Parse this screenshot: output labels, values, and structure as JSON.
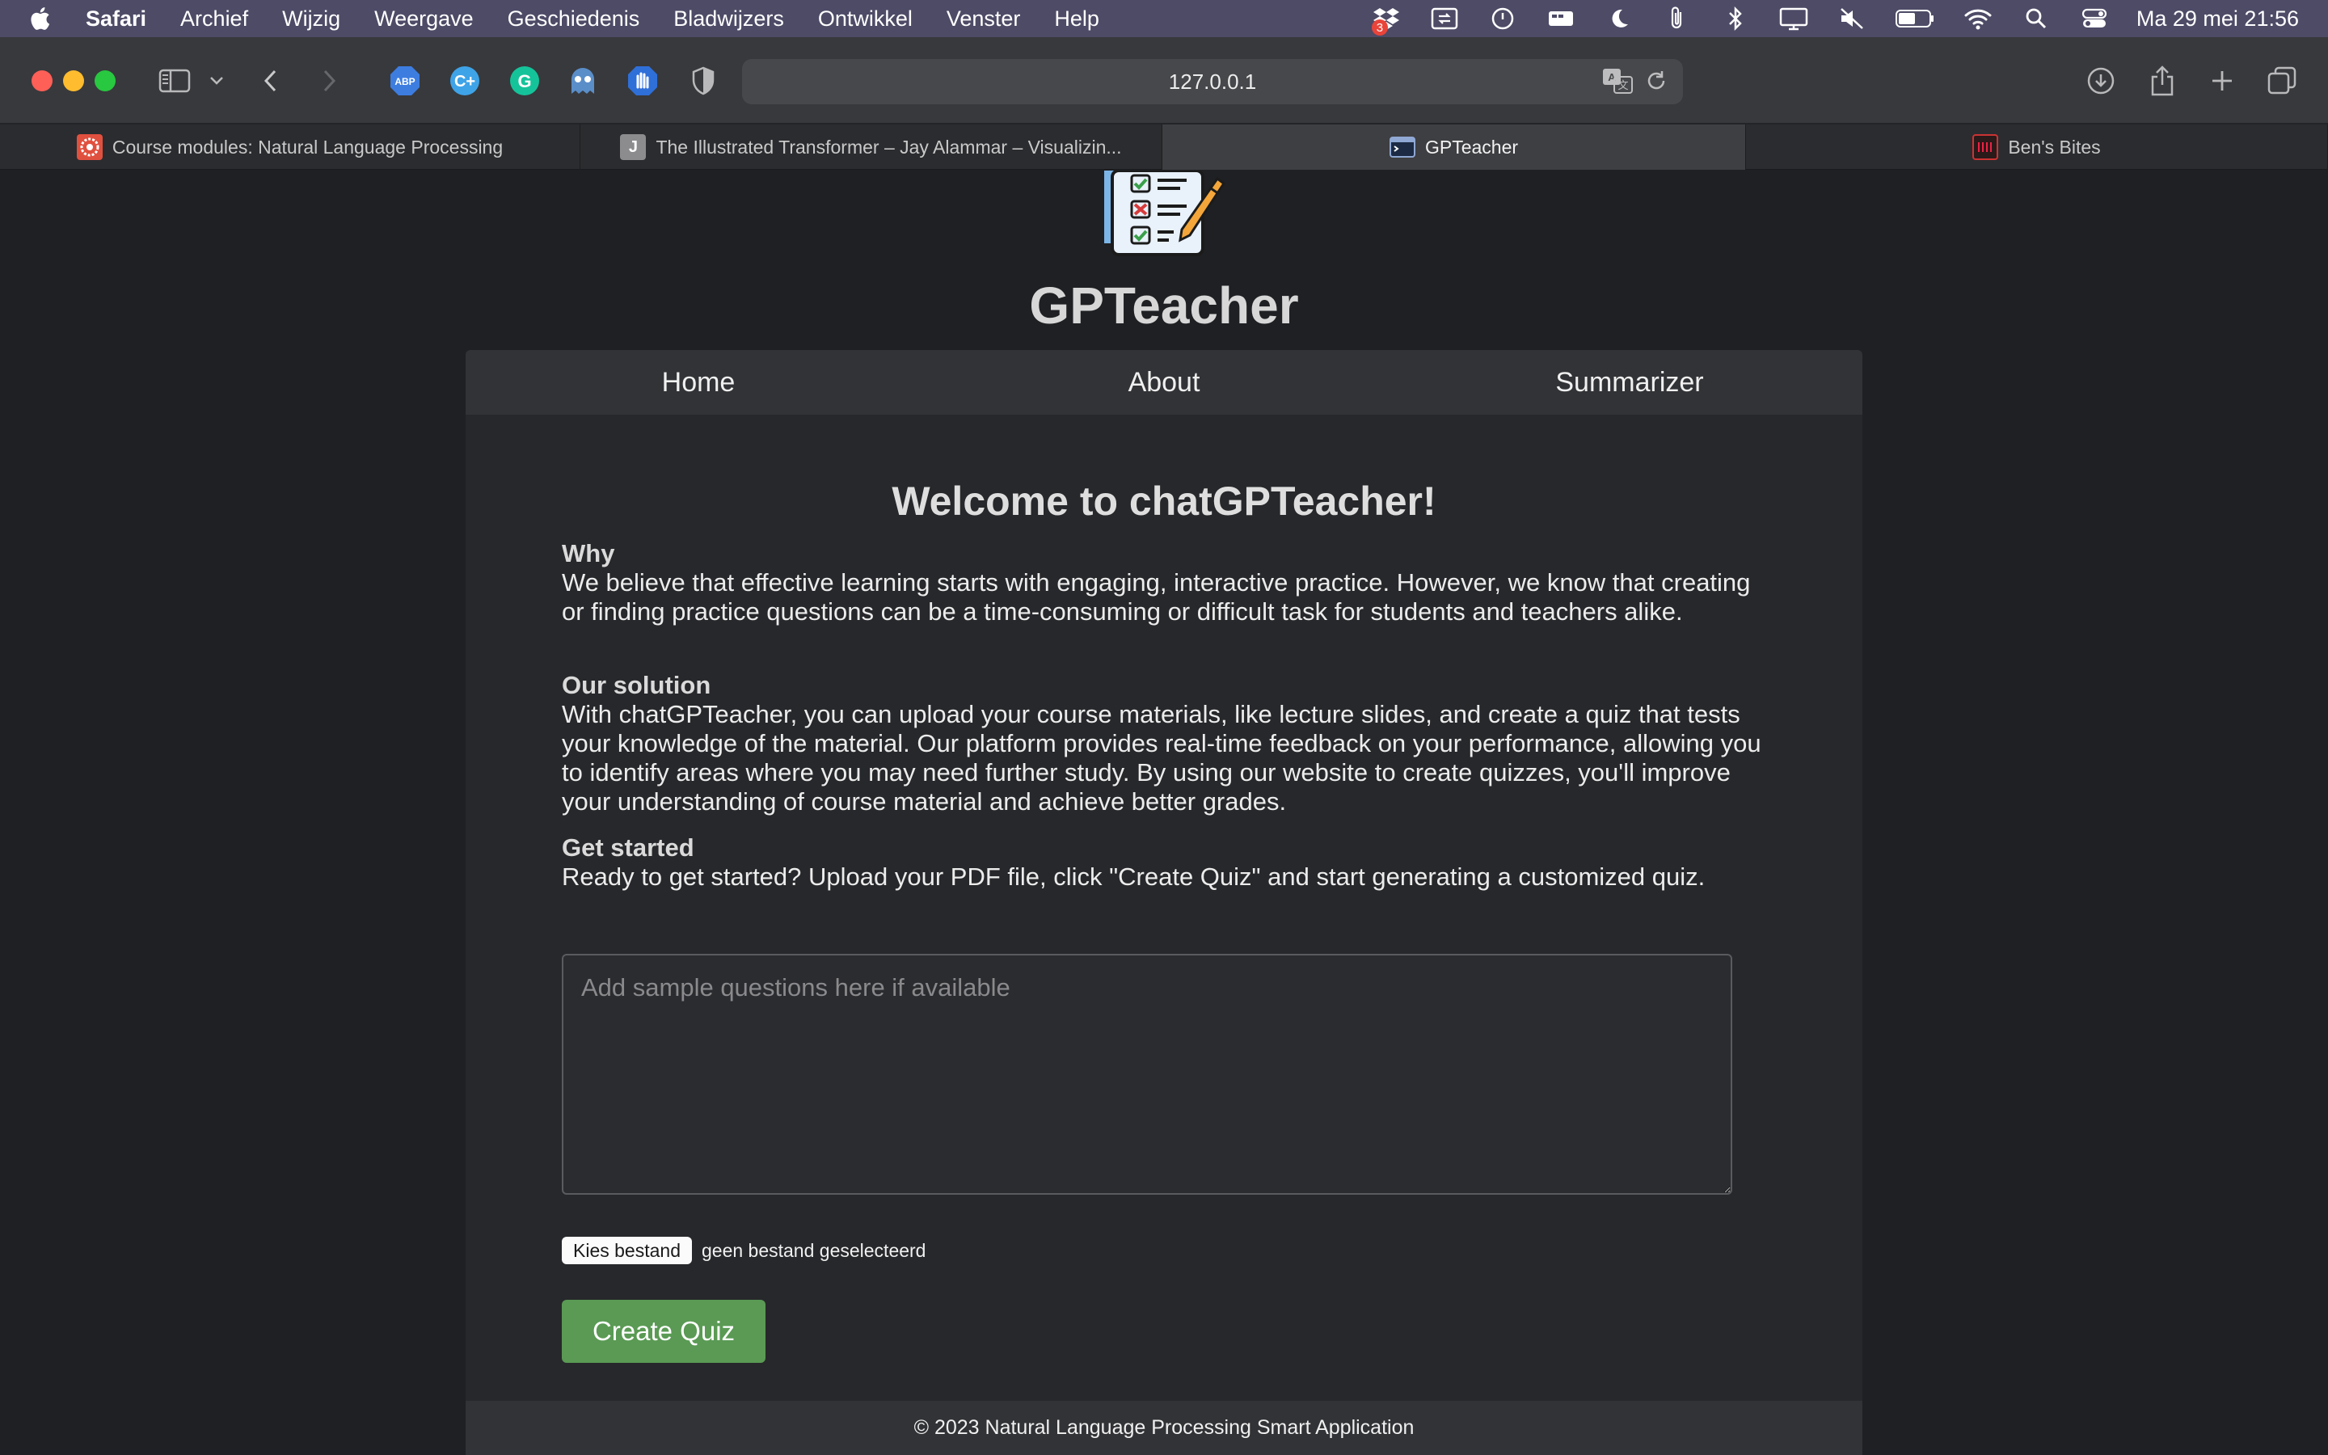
{
  "menubar": {
    "app_name": "Safari",
    "items": [
      "Archief",
      "Wijzig",
      "Weergave",
      "Geschiedenis",
      "Bladwijzers",
      "Ontwikkel",
      "Venster",
      "Help"
    ],
    "status_icons": [
      "dropbox-icon",
      "screen-share-icon",
      "power-icon",
      "battery-widget-icon",
      "moon-icon",
      "paperclip-icon",
      "bluetooth-icon",
      "display-icon",
      "mute-icon",
      "battery-icon",
      "wifi-icon",
      "spotlight-search-icon",
      "control-center-icon"
    ],
    "dropbox_badge": "3",
    "clock": "Ma 29 mei  21:56"
  },
  "toolbar": {
    "address": "127.0.0.1",
    "extensions": [
      "adblock-plus-icon",
      "cplus-icon",
      "grammarly-icon",
      "ghost-icon",
      "hand-icon",
      "shield-icon"
    ]
  },
  "tabs": [
    {
      "title": "Course modules: Natural Language Processing",
      "favicon": "course-icon",
      "active": false
    },
    {
      "title": "The Illustrated Transformer – Jay Alammar – Visualizin...",
      "favicon": "J",
      "active": false
    },
    {
      "title": "GPTeacher",
      "favicon": "terminal-icon",
      "active": true
    },
    {
      "title": "Ben's Bites",
      "favicon": "bens-bites-icon",
      "active": false
    }
  ],
  "site": {
    "title": "GPTeacher",
    "nav": [
      "Home",
      "About",
      "Summarizer"
    ],
    "welcome": "Welcome to chatGPTeacher!",
    "sections": [
      {
        "heading": "Why",
        "body": "We believe that effective learning starts with engaging, interactive practice. However, we know that creating or finding practice questions can be a time-consuming or difficult task for students and teachers alike."
      },
      {
        "heading": "Our solution",
        "body": "With chatGPTeacher, you can upload your course materials, like lecture slides, and create a quiz that tests your knowledge of the material. Our platform provides real-time feedback on your performance, allowing you to identify areas where you may need further study. By using our website to create quizzes, you'll improve your understanding of course material and achieve better grades."
      },
      {
        "heading": "Get started",
        "body": "Ready to get started? Upload your PDF file, click \"Create Quiz\" and start generating a customized quiz."
      }
    ],
    "sample_placeholder": "Add sample questions here if available",
    "sample_value": "",
    "file_button": "Kies bestand",
    "file_status": "geen bestand geselecteerd",
    "create_button": "Create Quiz",
    "footer": "© 2023 Natural Language Processing Smart Application"
  },
  "colors": {
    "menubar": "#4d4b66",
    "page_bg": "#1f2023",
    "panel_bg": "#27282b",
    "nav_bg": "#323336",
    "create_button": "#5a9a54"
  }
}
